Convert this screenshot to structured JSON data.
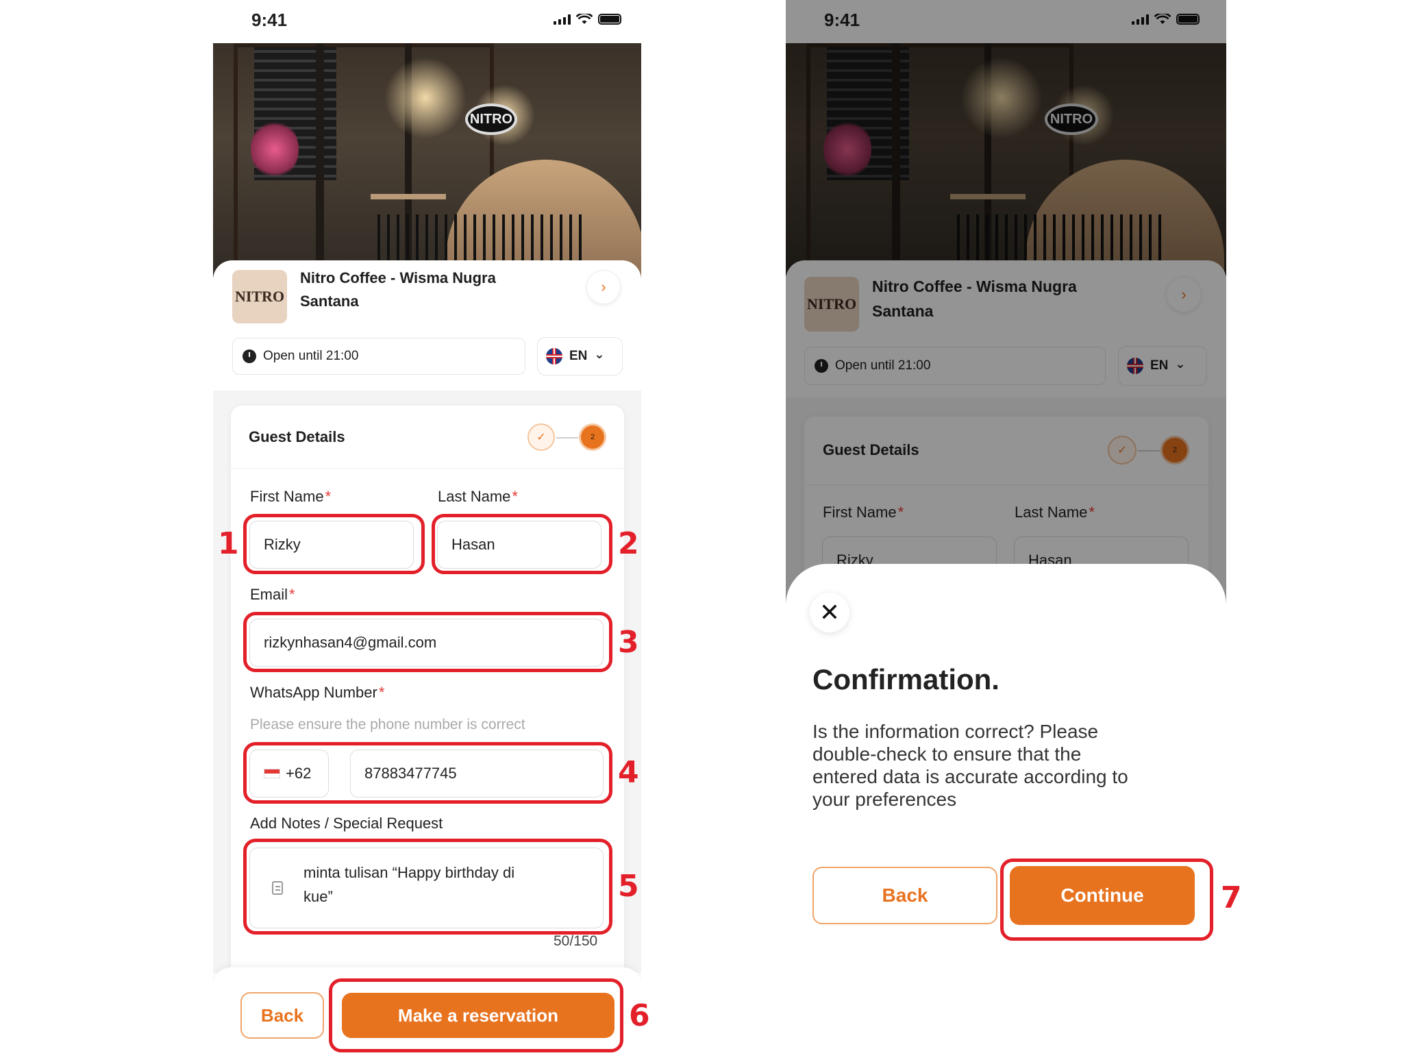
{
  "left": {
    "status_time": "9:41",
    "store_logo_text": "NITRO",
    "store_name_line1": "Nitro Coffee - Wisma Nugra",
    "store_name_line2": "Santana",
    "hours": "Open until 21:00",
    "language": "EN",
    "form_title": "Guest Details",
    "step_current": "2",
    "first_name_label": "First Name",
    "last_name_label": "Last Name",
    "first_name_value": "Rizky",
    "last_name_value": "Hasan",
    "email_label": "Email",
    "email_value": "rizkynhasan4@gmail.com",
    "whatsapp_label": "WhatsApp Number",
    "whatsapp_hint": "Please ensure the phone number is correct",
    "country_code": "+62",
    "phone_value": "87883477745",
    "notes_label": "Add Notes / Special Request",
    "notes_line1": "minta tulisan “Happy birthday di",
    "notes_line2": "kue”",
    "notes_counter": "50/150",
    "back_label": "Back",
    "reserve_label": "Make a reservation"
  },
  "right": {
    "status_time": "9:41",
    "store_logo_text": "NITRO",
    "store_name_line1": "Nitro Coffee - Wisma Nugra",
    "store_name_line2": "Santana",
    "hours": "Open until 21:00",
    "language": "EN",
    "form_title": "Guest Details",
    "step_current": "2",
    "first_name_label": "First Name",
    "last_name_label": "Last Name",
    "first_name_value": "Rizky",
    "last_name_value": "Hasan",
    "close_icon": "✕",
    "dialog_title": "Confirmation.",
    "dialog_line1": "Is the information correct? Please",
    "dialog_line2": "double-check to ensure that the",
    "dialog_line3": "entered data is accurate according to",
    "dialog_line4": "your preferences",
    "back_label": "Back",
    "continue_label": "Continue"
  },
  "annotations": [
    "1",
    "2",
    "3",
    "4",
    "5",
    "6",
    "7"
  ],
  "icons": {
    "chevron_right": "›",
    "chevron_down": "⌄",
    "check": "✓",
    "close": "✕"
  },
  "colors": {
    "accent": "#e8731f",
    "highlight": "#e3202a",
    "required": "#e53935"
  }
}
